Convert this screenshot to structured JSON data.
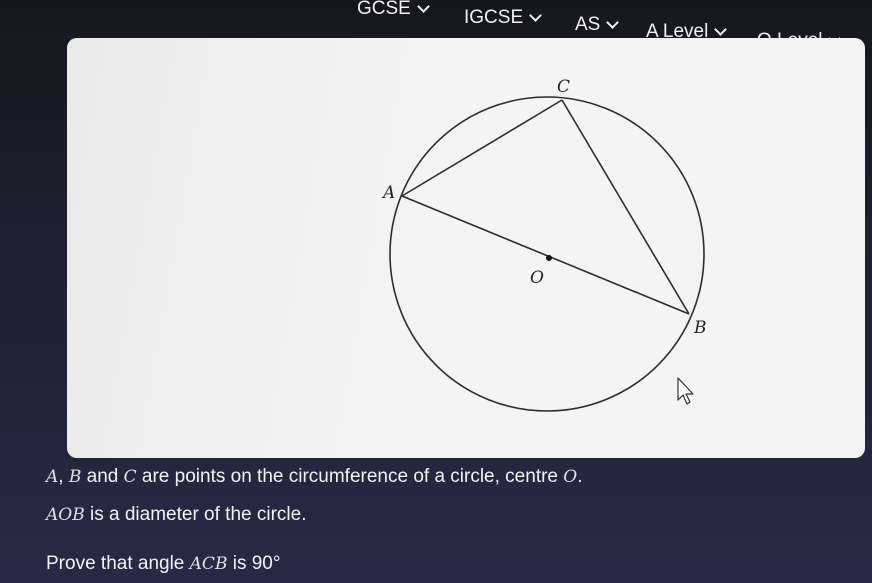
{
  "nav": {
    "items": [
      {
        "label": "GCSE"
      },
      {
        "label": "IGCSE"
      },
      {
        "label": "AS"
      },
      {
        "label": "A Level"
      },
      {
        "label": "O Level"
      }
    ]
  },
  "diagram": {
    "point_labels": {
      "a": "A",
      "b": "B",
      "c": "C",
      "o": "O"
    }
  },
  "question": {
    "line1": {
      "p1": "A",
      "p2": ", ",
      "p3": "B",
      "p4": " and ",
      "p5": "C",
      "p6": " are points on the circumference of a circle, centre ",
      "p7": "O",
      "p8": "."
    },
    "line2": {
      "p1": "AOB",
      "p2": " is a diameter of the circle."
    },
    "line3": {
      "p1": "Prove that angle ",
      "p2": "ACB",
      "p3": " is 90°"
    }
  }
}
